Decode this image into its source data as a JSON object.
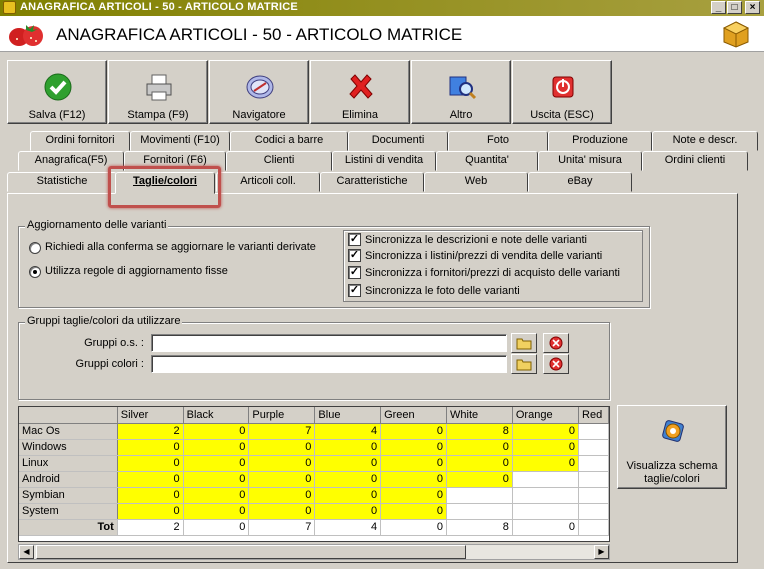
{
  "window": {
    "title": "ANAGRAFICA ARTICOLI - 50 - ARTICOLO MATRICE",
    "header_title": "ANAGRAFICA ARTICOLI - 50 - ARTICOLO MATRICE",
    "controls": [
      "_",
      "□",
      "×"
    ]
  },
  "toolbar": [
    {
      "label": "Salva (F12)",
      "icon": "check-icon"
    },
    {
      "label": "Stampa (F9)",
      "icon": "printer-icon"
    },
    {
      "label": "Navigatore",
      "icon": "compass-icon"
    },
    {
      "label": "Elimina",
      "icon": "delete-icon"
    },
    {
      "label": "Altro",
      "icon": "magnifier-icon"
    },
    {
      "label": "Uscita (ESC)",
      "icon": "exit-icon"
    }
  ],
  "tabs": {
    "row1": [
      "Ordini fornitori",
      "Movimenti (F10)",
      "Codici a barre",
      "Documenti",
      "Foto",
      "Produzione",
      "Note e descr."
    ],
    "row2": [
      "Anagrafica(F5)",
      "Fornitori (F6)",
      "Clienti",
      "Listini di vendita",
      "Quantita'",
      "Unita' misura",
      "Ordini clienti"
    ],
    "row3": [
      "Statistiche",
      "Taglie/colori",
      "Articoli coll.",
      "Caratteristiche",
      "Web",
      "eBay"
    ],
    "active": "Taglie/colori"
  },
  "aggiornamento": {
    "legend": "Aggiornamento delle varianti",
    "radio1": "Richiedi alla conferma se aggiornare le varianti derivate",
    "radio2": "Utilizza regole di aggiornamento fisse",
    "selected_radio": 2,
    "checks": [
      {
        "label": "Sincronizza le descrizioni e note delle varianti",
        "checked": true
      },
      {
        "label": "Sincronizza i listini/prezzi di vendita delle varianti",
        "checked": true
      },
      {
        "label": "Sincronizza i fornitori/prezzi di acquisto delle varianti",
        "checked": true
      },
      {
        "label": "Sincronizza le foto delle varianti",
        "checked": true
      }
    ]
  },
  "gruppi": {
    "legend": "Gruppi taglie/colori da utilizzare",
    "os_label": "Gruppi o.s. :",
    "os_value": "",
    "colori_label": "Gruppi colori :",
    "colori_value": ""
  },
  "grid": {
    "columns": [
      "Silver",
      "Black",
      "Purple",
      "Blue",
      "Green",
      "White",
      "Orange",
      "Red"
    ],
    "rows": [
      {
        "name": "Mac Os",
        "values": [
          "2",
          "0",
          "7",
          "4",
          "0",
          "8",
          "0",
          ""
        ]
      },
      {
        "name": "Windows",
        "values": [
          "0",
          "0",
          "0",
          "0",
          "0",
          "0",
          "0",
          ""
        ]
      },
      {
        "name": "Linux",
        "values": [
          "0",
          "0",
          "0",
          "0",
          "0",
          "0",
          "0",
          ""
        ]
      },
      {
        "name": "Android",
        "values": [
          "0",
          "0",
          "0",
          "0",
          "0",
          "0",
          "",
          ""
        ]
      },
      {
        "name": "Symbian",
        "values": [
          "0",
          "0",
          "0",
          "0",
          "0",
          "",
          "",
          ""
        ]
      },
      {
        "name": "System",
        "values": [
          "0",
          "0",
          "0",
          "0",
          "0",
          "",
          "",
          ""
        ]
      }
    ],
    "yellow_filled": [
      7,
      7,
      7,
      6,
      5,
      5
    ],
    "total_label": "Tot",
    "totals": [
      "2",
      "0",
      "7",
      "4",
      "0",
      "8",
      "0",
      ""
    ]
  },
  "schema_button": "Visualizza schema taglie/colori",
  "colors": {
    "highlight": "#c0504d",
    "cell_fill": "#ffff00",
    "titlebar": "#808000"
  }
}
